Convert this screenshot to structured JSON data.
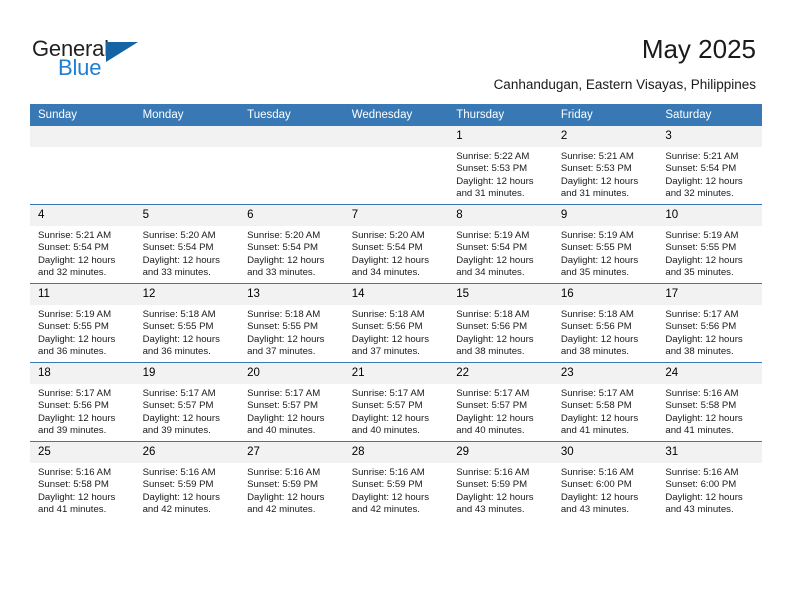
{
  "brand": {
    "name_part1": "General",
    "name_part2": "Blue",
    "triangle_icon": "triangle-logo-icon",
    "color_dark": "#231f20",
    "color_blue": "#1f7fd0"
  },
  "header": {
    "title": "May 2025",
    "subtitle": "Canhandugan, Eastern Visayas, Philippines"
  },
  "theme": {
    "header_bg": "#3878b4",
    "daynum_bg": "#f2f2f2",
    "grid_line": "#3878b4"
  },
  "weekdays": [
    "Sunday",
    "Monday",
    "Tuesday",
    "Wednesday",
    "Thursday",
    "Friday",
    "Saturday"
  ],
  "weeks": [
    [
      {
        "day": "",
        "blank": true
      },
      {
        "day": "",
        "blank": true
      },
      {
        "day": "",
        "blank": true
      },
      {
        "day": "",
        "blank": true
      },
      {
        "day": "1",
        "sunrise": "Sunrise: 5:22 AM",
        "sunset": "Sunset: 5:53 PM",
        "daylight": "Daylight: 12 hours and 31 minutes."
      },
      {
        "day": "2",
        "sunrise": "Sunrise: 5:21 AM",
        "sunset": "Sunset: 5:53 PM",
        "daylight": "Daylight: 12 hours and 31 minutes."
      },
      {
        "day": "3",
        "sunrise": "Sunrise: 5:21 AM",
        "sunset": "Sunset: 5:54 PM",
        "daylight": "Daylight: 12 hours and 32 minutes."
      }
    ],
    [
      {
        "day": "4",
        "sunrise": "Sunrise: 5:21 AM",
        "sunset": "Sunset: 5:54 PM",
        "daylight": "Daylight: 12 hours and 32 minutes."
      },
      {
        "day": "5",
        "sunrise": "Sunrise: 5:20 AM",
        "sunset": "Sunset: 5:54 PM",
        "daylight": "Daylight: 12 hours and 33 minutes."
      },
      {
        "day": "6",
        "sunrise": "Sunrise: 5:20 AM",
        "sunset": "Sunset: 5:54 PM",
        "daylight": "Daylight: 12 hours and 33 minutes."
      },
      {
        "day": "7",
        "sunrise": "Sunrise: 5:20 AM",
        "sunset": "Sunset: 5:54 PM",
        "daylight": "Daylight: 12 hours and 34 minutes."
      },
      {
        "day": "8",
        "sunrise": "Sunrise: 5:19 AM",
        "sunset": "Sunset: 5:54 PM",
        "daylight": "Daylight: 12 hours and 34 minutes."
      },
      {
        "day": "9",
        "sunrise": "Sunrise: 5:19 AM",
        "sunset": "Sunset: 5:55 PM",
        "daylight": "Daylight: 12 hours and 35 minutes."
      },
      {
        "day": "10",
        "sunrise": "Sunrise: 5:19 AM",
        "sunset": "Sunset: 5:55 PM",
        "daylight": "Daylight: 12 hours and 35 minutes."
      }
    ],
    [
      {
        "day": "11",
        "sunrise": "Sunrise: 5:19 AM",
        "sunset": "Sunset: 5:55 PM",
        "daylight": "Daylight: 12 hours and 36 minutes."
      },
      {
        "day": "12",
        "sunrise": "Sunrise: 5:18 AM",
        "sunset": "Sunset: 5:55 PM",
        "daylight": "Daylight: 12 hours and 36 minutes."
      },
      {
        "day": "13",
        "sunrise": "Sunrise: 5:18 AM",
        "sunset": "Sunset: 5:55 PM",
        "daylight": "Daylight: 12 hours and 37 minutes."
      },
      {
        "day": "14",
        "sunrise": "Sunrise: 5:18 AM",
        "sunset": "Sunset: 5:56 PM",
        "daylight": "Daylight: 12 hours and 37 minutes."
      },
      {
        "day": "15",
        "sunrise": "Sunrise: 5:18 AM",
        "sunset": "Sunset: 5:56 PM",
        "daylight": "Daylight: 12 hours and 38 minutes."
      },
      {
        "day": "16",
        "sunrise": "Sunrise: 5:18 AM",
        "sunset": "Sunset: 5:56 PM",
        "daylight": "Daylight: 12 hours and 38 minutes."
      },
      {
        "day": "17",
        "sunrise": "Sunrise: 5:17 AM",
        "sunset": "Sunset: 5:56 PM",
        "daylight": "Daylight: 12 hours and 38 minutes."
      }
    ],
    [
      {
        "day": "18",
        "sunrise": "Sunrise: 5:17 AM",
        "sunset": "Sunset: 5:56 PM",
        "daylight": "Daylight: 12 hours and 39 minutes."
      },
      {
        "day": "19",
        "sunrise": "Sunrise: 5:17 AM",
        "sunset": "Sunset: 5:57 PM",
        "daylight": "Daylight: 12 hours and 39 minutes."
      },
      {
        "day": "20",
        "sunrise": "Sunrise: 5:17 AM",
        "sunset": "Sunset: 5:57 PM",
        "daylight": "Daylight: 12 hours and 40 minutes."
      },
      {
        "day": "21",
        "sunrise": "Sunrise: 5:17 AM",
        "sunset": "Sunset: 5:57 PM",
        "daylight": "Daylight: 12 hours and 40 minutes."
      },
      {
        "day": "22",
        "sunrise": "Sunrise: 5:17 AM",
        "sunset": "Sunset: 5:57 PM",
        "daylight": "Daylight: 12 hours and 40 minutes."
      },
      {
        "day": "23",
        "sunrise": "Sunrise: 5:17 AM",
        "sunset": "Sunset: 5:58 PM",
        "daylight": "Daylight: 12 hours and 41 minutes."
      },
      {
        "day": "24",
        "sunrise": "Sunrise: 5:16 AM",
        "sunset": "Sunset: 5:58 PM",
        "daylight": "Daylight: 12 hours and 41 minutes."
      }
    ],
    [
      {
        "day": "25",
        "sunrise": "Sunrise: 5:16 AM",
        "sunset": "Sunset: 5:58 PM",
        "daylight": "Daylight: 12 hours and 41 minutes."
      },
      {
        "day": "26",
        "sunrise": "Sunrise: 5:16 AM",
        "sunset": "Sunset: 5:59 PM",
        "daylight": "Daylight: 12 hours and 42 minutes."
      },
      {
        "day": "27",
        "sunrise": "Sunrise: 5:16 AM",
        "sunset": "Sunset: 5:59 PM",
        "daylight": "Daylight: 12 hours and 42 minutes."
      },
      {
        "day": "28",
        "sunrise": "Sunrise: 5:16 AM",
        "sunset": "Sunset: 5:59 PM",
        "daylight": "Daylight: 12 hours and 42 minutes."
      },
      {
        "day": "29",
        "sunrise": "Sunrise: 5:16 AM",
        "sunset": "Sunset: 5:59 PM",
        "daylight": "Daylight: 12 hours and 43 minutes."
      },
      {
        "day": "30",
        "sunrise": "Sunrise: 5:16 AM",
        "sunset": "Sunset: 6:00 PM",
        "daylight": "Daylight: 12 hours and 43 minutes."
      },
      {
        "day": "31",
        "sunrise": "Sunrise: 5:16 AM",
        "sunset": "Sunset: 6:00 PM",
        "daylight": "Daylight: 12 hours and 43 minutes."
      }
    ]
  ]
}
